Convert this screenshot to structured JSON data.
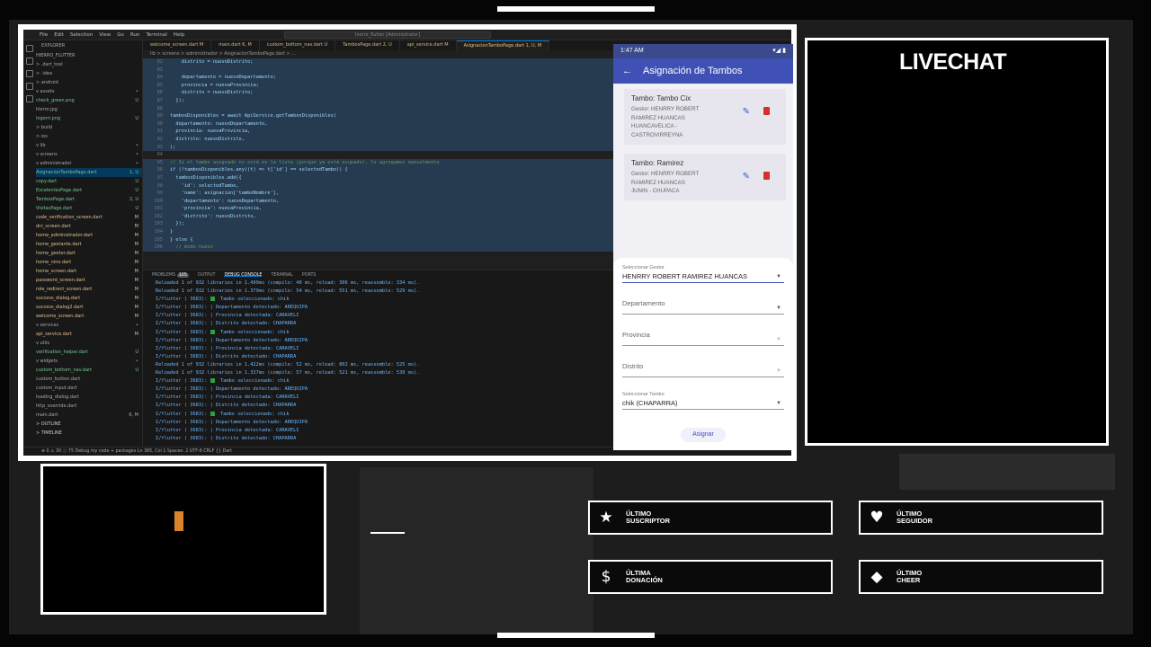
{
  "vscode": {
    "menu": [
      "File",
      "Edit",
      "Selection",
      "View",
      "Go",
      "Run",
      "Terminal",
      "Help"
    ],
    "command_center": "hierro_flutter [Administrator]",
    "tabs": [
      "welcome_screen.dart M",
      "main.dart 6, M",
      "custom_bottom_nav.dart U",
      "TambosPage.dart 2, U",
      "api_service.dart M",
      "AsignacionTamboPage.dart 1, U, M"
    ],
    "breadcrumb": "lib > screens > administrador > AsignacionTamboPage.dart > ...",
    "explorer": {
      "header": "EXPLORER",
      "items": [
        {
          "name": "HIERRO_FLUTTER",
          "status": ""
        },
        {
          "name": "  > .dart_tool",
          "status": ""
        },
        {
          "name": "  > .idea",
          "status": ""
        },
        {
          "name": "  > android",
          "status": ""
        },
        {
          "name": "  v assets",
          "status": "•"
        },
        {
          "name": "     check_green.png",
          "status": "U"
        },
        {
          "name": "     hierro.jpg",
          "status": ""
        },
        {
          "name": "     logorri.png",
          "status": "U"
        },
        {
          "name": "  > build",
          "status": ""
        },
        {
          "name": "  > ios",
          "status": ""
        },
        {
          "name": "  v lib",
          "status": "•"
        },
        {
          "name": "    v screens",
          "status": "•"
        },
        {
          "name": "      v administrador",
          "status": "•"
        },
        {
          "name": "         AsignacionTamboPage.dart",
          "status": "1, U"
        },
        {
          "name": "         copy.dart",
          "status": "U"
        },
        {
          "name": "         ExcelentesPage.dart",
          "status": "U"
        },
        {
          "name": "         TambosPage.dart",
          "status": "2, U"
        },
        {
          "name": "         VisitasPage.dart",
          "status": "U"
        },
        {
          "name": "       code_verification_screen.dart",
          "status": "M"
        },
        {
          "name": "       dni_screen.dart",
          "status": "M"
        },
        {
          "name": "       home_administrador.dart",
          "status": "M"
        },
        {
          "name": "       home_gestante.dart",
          "status": "M"
        },
        {
          "name": "       home_gestor.dart",
          "status": "M"
        },
        {
          "name": "       home_nino.dart",
          "status": "M"
        },
        {
          "name": "       home_screen.dart",
          "status": "M"
        },
        {
          "name": "       password_screen.dart",
          "status": "M"
        },
        {
          "name": "       role_redirect_screen.dart",
          "status": "M"
        },
        {
          "name": "       success_dialog.dart",
          "status": "M"
        },
        {
          "name": "       success_dialog2.dart",
          "status": "M"
        },
        {
          "name": "       welcome_screen.dart",
          "status": "M"
        },
        {
          "name": "    v services",
          "status": "•"
        },
        {
          "name": "       api_service.dart",
          "status": "M"
        },
        {
          "name": "    v utils",
          "status": ""
        },
        {
          "name": "       verification_helper.dart",
          "status": "U"
        },
        {
          "name": "    v widgets",
          "status": "•"
        },
        {
          "name": "       custom_bottom_nav.dart",
          "status": "U"
        },
        {
          "name": "       custom_button.dart",
          "status": ""
        },
        {
          "name": "       custom_input.dart",
          "status": ""
        },
        {
          "name": "       loading_dialog.dart",
          "status": ""
        },
        {
          "name": "    http_override.dart",
          "status": ""
        },
        {
          "name": "    main.dart",
          "status": "6, M"
        }
      ],
      "footer": [
        "OUTLINE",
        "TIMELINE"
      ]
    },
    "code": [
      {
        "n": "82",
        "t": "    distrito = nuevoDistrito;",
        "hl": true
      },
      {
        "n": "83",
        "t": "",
        "hl": true
      },
      {
        "n": "84",
        "t": "    departamento = nuevoDepartamento;",
        "hl": true
      },
      {
        "n": "85",
        "t": "    provincia = nuevaProvincia;",
        "hl": true
      },
      {
        "n": "86",
        "t": "    distrito = nuevoDistrito;",
        "hl": true
      },
      {
        "n": "87",
        "t": "  });",
        "hl": true
      },
      {
        "n": "88",
        "t": "",
        "hl": true
      },
      {
        "n": "89",
        "t": "tambosDisponibles = await ApiService.getTambosDisponibles(",
        "hl": true
      },
      {
        "n": "90",
        "t": "  departamento: nuevoDepartamento,",
        "hl": true
      },
      {
        "n": "91",
        "t": "  provincia: nuevaProvincia,",
        "hl": true
      },
      {
        "n": "92",
        "t": "  distrito: nuevoDistrito,",
        "hl": true
      },
      {
        "n": "93",
        "t": ");",
        "hl": true
      },
      {
        "n": "94",
        "t": "",
        "hl": false
      },
      {
        "n": "95",
        "t": "// Si el tambo asignado no está en la lista (porque ya está ocupado), lo agregamos manualmente",
        "hl": true
      },
      {
        "n": "96",
        "t": "if (!tambosDisponibles.any((t) => t['id'] == selectedTambo)) {",
        "hl": true
      },
      {
        "n": "97",
        "t": "  tambosDisponibles.add({",
        "hl": true
      },
      {
        "n": "98",
        "t": "    'id': selectedTambo,",
        "hl": true
      },
      {
        "n": "99",
        "t": "    'name': asignacion['tamboNombre'],",
        "hl": true
      },
      {
        "n": "100",
        "t": "    'departamento': nuevoDepartamento,",
        "hl": true
      },
      {
        "n": "101",
        "t": "    'provincia': nuevaProvincia,",
        "hl": true
      },
      {
        "n": "102",
        "t": "    'distrito': nuevoDistrito,",
        "hl": true
      },
      {
        "n": "103",
        "t": "  });",
        "hl": true
      },
      {
        "n": "104",
        "t": "}",
        "hl": true
      },
      {
        "n": "105",
        "t": "} else {",
        "hl": true
      },
      {
        "n": "106",
        "t": "  // modo nuevo",
        "hl": true
      }
    ],
    "panel_tabs": {
      "problems": "PROBLEMS",
      "problems_count": "105",
      "output": "OUTPUT",
      "debug": "DEBUG CONSOLE",
      "terminal": "TERMINAL",
      "ports": "PORTS"
    },
    "logs": [
      {
        "t": "Reloaded 1 of 932 libraries in 1.499ms (compile: 40 ms, reload: 306 ms, reassemble: 334 ms).",
        "chk": false
      },
      {
        "t": "Reloaded 1 of 932 libraries in 1.379ms (compile: 54 ms, reload: 551 ms, reassemble: 529 ms).",
        "chk": false
      },
      {
        "t": "I/flutter ( 3683):   Tambo seleccionado: chik",
        "chk": true
      },
      {
        "t": "I/flutter ( 3683): | Departamento detectado: AREQUIPA",
        "chk": false
      },
      {
        "t": "I/flutter ( 3683): | Provincia detectada: CARAVELI",
        "chk": false
      },
      {
        "t": "I/flutter ( 3683): | Distrito detectado: CHAPARRA",
        "chk": false
      },
      {
        "t": "I/flutter ( 3683):   Tambo seleccionado: chik",
        "chk": true
      },
      {
        "t": "I/flutter ( 3683): | Departamento detectado: AREQUIPA",
        "chk": false
      },
      {
        "t": "I/flutter ( 3683): | Provincia detectada: CARAVELI",
        "chk": false
      },
      {
        "t": "I/flutter ( 3683): | Distrito detectado: CHAPARRA",
        "chk": false
      },
      {
        "t": "Reloaded 1 of 932 libraries in 1.422ms (compile: 52 ms, reload: 802 ms, reassemble: 525 ms).",
        "chk": false
      },
      {
        "t": "Reloaded 1 of 932 libraries in 1.337ms (compile: 57 ms, reload: 521 ms, reassemble: 530 ms).",
        "chk": false
      },
      {
        "t": "I/flutter ( 3683):   Tambo seleccionado: chik",
        "chk": true
      },
      {
        "t": "I/flutter ( 3683): | Departamento detectado: AREQUIPA",
        "chk": false
      },
      {
        "t": "I/flutter ( 3683): | Provincia detectada: CARAVELI",
        "chk": false
      },
      {
        "t": "I/flutter ( 3683): | Distrito detectado: CHAPARRA",
        "chk": false
      },
      {
        "t": "I/flutter ( 3683):   Tambo seleccionado: chik",
        "chk": true
      },
      {
        "t": "I/flutter ( 3683): | Departamento detectado: AREQUIPA",
        "chk": false
      },
      {
        "t": "I/flutter ( 3683): | Provincia detectada: CARAVELI",
        "chk": false
      },
      {
        "t": "I/flutter ( 3683): | Distrito detectado: CHAPARRA",
        "chk": false
      }
    ],
    "statusbar": "⊗ 0 ⚠ 30  ⓘ 75    Debug my code + packages                                                       Ln 385, Col 1   Spaces: 2   UTF-8   CRLF   {} Dart"
  },
  "phone": {
    "time": "1:47 AM",
    "status_right": "▾◢ ▮",
    "back_icon": "←",
    "title": "Asignación de Tambos",
    "cards": [
      {
        "title": "Tambo: Tambo Cix",
        "lines": [
          "Gestor: HENRRY ROBERT",
          "RAMIREZ HUANCAS",
          "HUANCAVELICA -",
          "CASTROVIRREYNA"
        ]
      },
      {
        "title": "Tambo: Ramirez",
        "lines": [
          "Gestor: HENRRY ROBERT",
          "RAMIREZ HUANCAS",
          "JUNIN - CHUPACA"
        ]
      }
    ],
    "sheet": {
      "gestor_caption": "Seleccionar Gestor",
      "gestor_value": "HENRRY ROBERT RAMIREZ HUANCAS",
      "departamento": "Departamento",
      "provincia": "Provincia",
      "distrito": "Distrito",
      "tambo_caption": "Seleccionar Tambo",
      "tambo_value": "chik (CHAPARRA)",
      "assign_button": "Asignar"
    }
  },
  "overlay": {
    "livechat": "LIVECHAT",
    "alerts": [
      {
        "icon": "★",
        "label": "ÚLTIMO\nSUSCRIPTOR",
        "name": "ultimo-suscriptor"
      },
      {
        "icon": "♥",
        "label": "ÚLTIMO\nSEGUIDOR",
        "name": "ultimo-seguidor"
      },
      {
        "icon": "$",
        "label": "ÚLTIMA\nDONACIÓN",
        "name": "ultima-donacion"
      },
      {
        "icon": "◆",
        "label": "ÚLTIMO\nCHEER",
        "name": "ultimo-cheer"
      }
    ]
  }
}
